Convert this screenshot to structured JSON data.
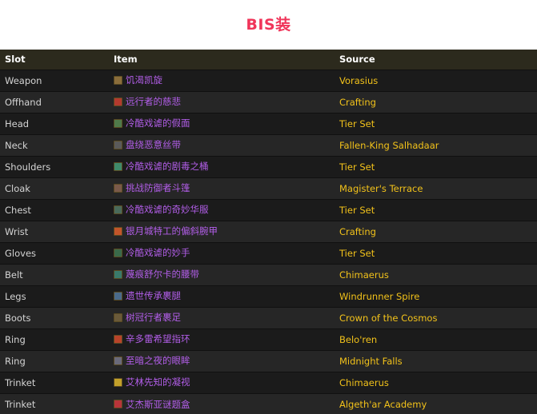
{
  "title": "BIS装",
  "columns": {
    "slot": "Slot",
    "item": "Item",
    "source": "Source"
  },
  "rows": [
    {
      "slot": "Weapon",
      "item": "饥渴凯旋",
      "source": "Vorasius",
      "icon": "weapon-icon",
      "icon_color": "#8a6d3b"
    },
    {
      "slot": "Offhand",
      "item": "远行者的慈悲",
      "source": "Crafting",
      "icon": "offhand-icon",
      "icon_color": "#b33a2e"
    },
    {
      "slot": "Head",
      "item": "冷酷戏谑的假面",
      "source": "Tier Set",
      "icon": "helm-icon",
      "icon_color": "#4f7a4a"
    },
    {
      "slot": "Neck",
      "item": "盘绕恶意丝带",
      "source": "Fallen-King Salhadaar",
      "icon": "neck-icon",
      "icon_color": "#5a5a5a"
    },
    {
      "slot": "Shoulders",
      "item": "冷酷戏谑的剧毒之桶",
      "source": "Tier Set",
      "icon": "shoulder-icon",
      "icon_color": "#3f8a6a"
    },
    {
      "slot": "Cloak",
      "item": "挑战防御者斗篷",
      "source": "Magister's Terrace",
      "icon": "cloak-icon",
      "icon_color": "#7a5a4a"
    },
    {
      "slot": "Chest",
      "item": "冷酷戏谑的奇妙华服",
      "source": "Tier Set",
      "icon": "chest-icon",
      "icon_color": "#4a6a5a"
    },
    {
      "slot": "Wrist",
      "item": "银月城特工的偏斜腕甲",
      "source": "Crafting",
      "icon": "wrist-icon",
      "icon_color": "#c2552a"
    },
    {
      "slot": "Gloves",
      "item": "冷酷戏谑的妙手",
      "source": "Tier Set",
      "icon": "gloves-icon",
      "icon_color": "#3a6a4a"
    },
    {
      "slot": "Belt",
      "item": "蔑痕舒尔卡的腰带",
      "source": "Chimaerus",
      "icon": "belt-icon",
      "icon_color": "#3a7a6a"
    },
    {
      "slot": "Legs",
      "item": "遗世传承裹腿",
      "source": "Windrunner Spire",
      "icon": "legs-icon",
      "icon_color": "#4a6a8a"
    },
    {
      "slot": "Boots",
      "item": "树冠行者裹足",
      "source": "Crown of the Cosmos",
      "icon": "boots-icon",
      "icon_color": "#6a5a3a"
    },
    {
      "slot": "Ring",
      "item": "辛多雷希望指环",
      "source": "Belo'ren",
      "icon": "ring-icon",
      "icon_color": "#b8432a"
    },
    {
      "slot": "Ring",
      "item": "至暗之夜的眼眸",
      "source": "Midnight Falls",
      "icon": "ring-icon",
      "icon_color": "#6a6a7a"
    },
    {
      "slot": "Trinket",
      "item": "艾林先知的凝视",
      "source": "Chimaerus",
      "icon": "trinket-icon",
      "icon_color": "#c2a02a"
    },
    {
      "slot": "Trinket",
      "item": "艾杰斯亚谜题盒",
      "source": "Algeth'ar Academy",
      "icon": "trinket-icon",
      "icon_color": "#b8343a"
    }
  ]
}
